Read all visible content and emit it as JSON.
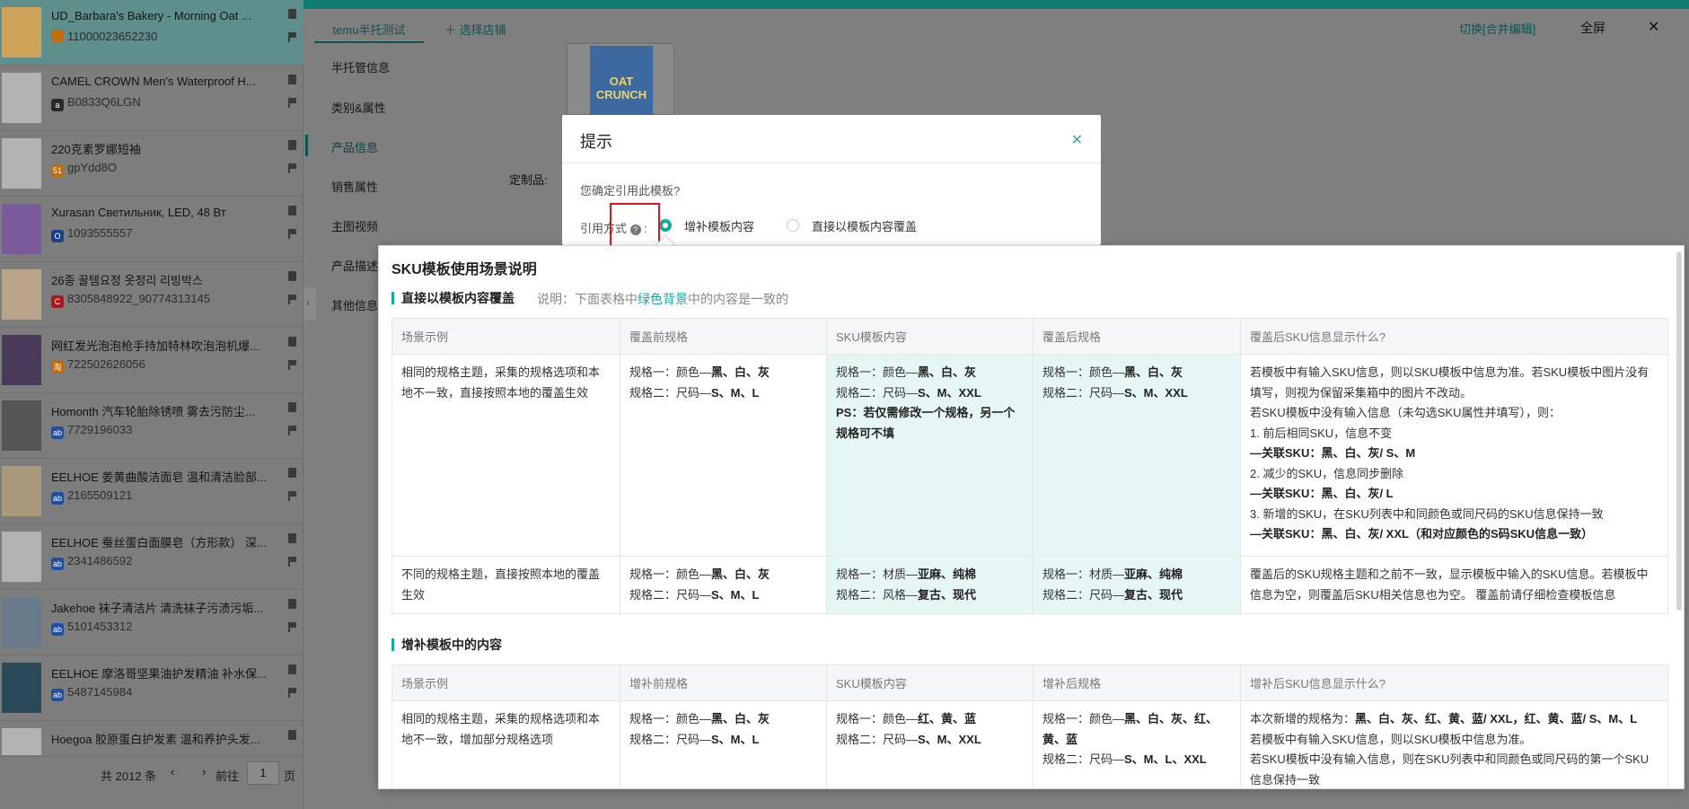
{
  "left_panel": {
    "products": [
      {
        "title": "UD_Barbara's Bakery - Morning Oat ...",
        "id": "11000023652230",
        "badge_color": "#c06a08"
      },
      {
        "title": "CAMEL CROWN Men's Waterproof H...",
        "id": "B0833Q6LGN",
        "badge_color": "#2a2a2a"
      },
      {
        "title": "220克素罗娜短袖",
        "id": "gpYdd8O",
        "badge_color": "#c06a08"
      },
      {
        "title": "Xurasan Светильник, LED, 48 Вт",
        "id": "1093555557",
        "badge_color": "#1e3f8c"
      },
      {
        "title": "26종 꿀템요정 옷정리 리빙박스",
        "id": "8305848922_90774313145",
        "badge_color": "#a71818"
      },
      {
        "title": "网红发光泡泡枪手持加特林吹泡泡机爆...",
        "id": "722502626056",
        "badge_color": "#c06a08"
      },
      {
        "title": "Homonth 汽车轮胎除锈喷 雾去污防尘...",
        "id": "7729196033",
        "badge_color": "#1e4fa0"
      },
      {
        "title": "EELHOE 姜黄曲酸洁面皂 温和清洁脸部...",
        "id": "2165509121",
        "badge_color": "#1e4fa0"
      },
      {
        "title": "EELHOE 蚕丝蛋白面膜皂（方形款） 深...",
        "id": "2341486592",
        "badge_color": "#1e4fa0"
      },
      {
        "title": "Jakehoe 袜子清洁片 清洗袜子污渍污垢...",
        "id": "5101453312",
        "badge_color": "#1e4fa0"
      },
      {
        "title": "EELHOE 摩洛哥坚果油护发精油 补水保...",
        "id": "5487145984",
        "badge_color": "#1e4fa0"
      },
      {
        "title": "Hoegoa 胶原蛋白护发素 温和养护头发...",
        "id": "",
        "badge_color": "#1e4fa0"
      }
    ],
    "pager": {
      "total": "共 2012 条",
      "prev": "前往",
      "page": "1",
      "suffix": "页"
    }
  },
  "header": {
    "tab_active": "temu半托测试",
    "tab_add": "＋ 选择店铺",
    "switch": "切换[合并编辑]",
    "fullscreen": "全屏",
    "close": "✕"
  },
  "subnav": [
    "半托管信息",
    "类别&属性",
    "产品信息",
    "销售属性",
    "主图视频",
    "产品描述",
    "其他信息"
  ],
  "bg_text": {
    "custom_label": "定制品:",
    "product_thumb": "OAT CRUNCH"
  },
  "dialog": {
    "title": "提示",
    "close": "✕",
    "question": "您确定引用此模板?",
    "ref_label": "引用方式",
    "help": "?",
    "opt1": "增补模板内容",
    "opt2": "直接以模板内容覆盖"
  },
  "popover": {
    "title": "SKU模板使用场景说明",
    "section1": {
      "title": "直接以模板内容覆盖",
      "note_prefix": "说明：下面表格中",
      "note_green": "绿色背景",
      "note_suffix": "中的内容是一致的",
      "headers": [
        "场景示例",
        "覆盖前规格",
        "SKU模板内容",
        "覆盖后规格",
        "覆盖后SKU信息显示什么?"
      ],
      "row1": {
        "scene": "相同的规格主题，采集的规格选项和本地不一致，直接按照本地的覆盖生效",
        "before": [
          "规格一：颜色—",
          "黑、白、灰",
          "规格二：尺码—",
          "S、M、L"
        ],
        "tpl": [
          "规格一：颜色—",
          "黑、白、灰",
          "规格二：尺码—",
          "S、M、XXL",
          "PS：若仅需修改一个规格，另一个规格可不填"
        ],
        "after": [
          "规格一：颜色—",
          "黑、白、灰",
          "规格二：尺码—",
          "S、M、XXL"
        ],
        "info": [
          "若模板中有输入SKU信息，则以SKU模板中信息为准。若SKU模板中图片没有填写，则视为保留采集箱中的图片不改动。",
          "若SKU模板中没有输入信息（未勾选SKU属性并填写），则：",
          "1. 前后相同SKU，信息不变",
          "—关联SKU：黑、白、灰/ S、M",
          "2. 减少的SKU，信息同步删除",
          "—关联SKU：黑、白、灰/ L",
          "3. 新增的SKU，在SKU列表中和同颜色或同尺码的SKU信息保持一致",
          "—关联SKU：黑、白、灰/ XXL（和对应颜色的S码SKU信息一致）"
        ]
      },
      "row2": {
        "scene": "不同的规格主题，直接按照本地的覆盖生效",
        "before": [
          "规格一：颜色—",
          "黑、白、灰",
          "规格二：尺码—",
          "S、M、L"
        ],
        "tpl": [
          "规格一：材质—",
          "亚麻、纯棉",
          "规格二：风格—",
          "复古、现代"
        ],
        "after": [
          "规格一：材质—",
          "亚麻、纯棉",
          "规格二：尺码—",
          "复古、现代"
        ],
        "info": "覆盖后的SKU规格主题和之前不一致，显示模板中输入的SKU信息。若模板中信息为空，则覆盖后SKU相关信息也为空。 覆盖前请仔细检查模板信息"
      }
    },
    "section2": {
      "title": "增补模板中的内容",
      "headers": [
        "场景示例",
        "增补前规格",
        "SKU模板内容",
        "增补后规格",
        "增补后SKU信息显示什么?"
      ],
      "row1": {
        "scene": "相同的规格主题，采集的规格选项和本地不一致，增加部分规格选项",
        "before": [
          "规格一：颜色—",
          "黑、白、灰",
          "规格二：尺码—",
          "S、M、L"
        ],
        "tpl": [
          "规格一：颜色—",
          "红、黄、蓝",
          "规格二：尺码—",
          "S、M、XXL"
        ],
        "after": [
          "规格一：颜色—",
          "黑、白、灰、红、黄、蓝",
          "规格二：尺码—",
          "S、M、L、XXL"
        ],
        "info": [
          "本次新增的规格为：",
          "黑、白、灰、红、黄、蓝/ XXL，红、黄、蓝/ S、M、L",
          "若模板中有输入SKU信息，则以SKU模板中信息为准。",
          "若SKU模板中没有输入信息，则在SKU列表中和同颜色或同尺码的第一个SKU信息保持一致"
        ]
      }
    }
  }
}
